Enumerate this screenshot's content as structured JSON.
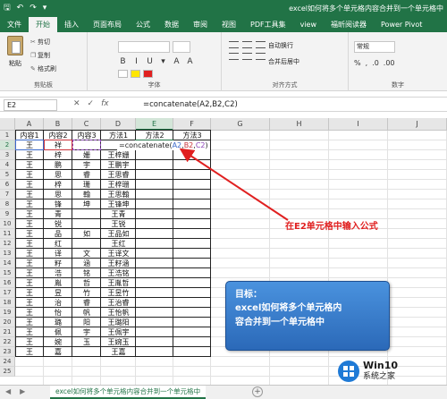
{
  "window": {
    "title": "excel如何将多个单元格内容合并到一个单元格中",
    "qat": {
      "save": "🖫",
      "undo": "↶",
      "redo": "↷",
      "more": "▾"
    }
  },
  "tabs": [
    "文件",
    "开始",
    "插入",
    "页面布局",
    "公式",
    "数据",
    "审阅",
    "视图",
    "PDF工具集",
    "view",
    "福昕阅读器",
    "Power Pivot"
  ],
  "ribbon": {
    "paste": "粘贴",
    "cut": "剪切",
    "copy": "复制",
    "format_painter": "格式刷",
    "clipboard": "剪贴板",
    "font_group": "字体",
    "font_buttons": [
      "B",
      "I",
      "U",
      "▾",
      "A",
      "A"
    ],
    "wrap_text": "自动换行",
    "merge_center": "合并后居中",
    "align_group": "对齐方式",
    "number_format": "常规",
    "number_buttons": [
      "%",
      ",",
      ".0",
      ".00"
    ],
    "number_group": "数字"
  },
  "formula_bar": {
    "name_box": "E2",
    "cancel": "✕",
    "confirm": "✓",
    "fx": "fx",
    "formula": "=concatenate(A2,B2,C2)"
  },
  "grid": {
    "columns": [
      "A",
      "B",
      "C",
      "D",
      "E",
      "F",
      "G",
      "H",
      "I",
      "J"
    ],
    "row_numbers": [
      1,
      2,
      3,
      4,
      5,
      6,
      7,
      8,
      9,
      10,
      11,
      12,
      13,
      14,
      15,
      16,
      17,
      18,
      19,
      20,
      21,
      22,
      23,
      24,
      25
    ],
    "headers": [
      "内容1",
      "内容2",
      "内容3",
      "方法1",
      "方法2",
      "方法3"
    ],
    "rows": [
      [
        "王",
        "祥",
        "",
        "",
        "",
        ""
      ],
      [
        "王",
        "梓",
        "姗",
        "王梓姗",
        "",
        ""
      ],
      [
        "王",
        "鹏",
        "宇",
        "王鹏宇",
        "",
        ""
      ],
      [
        "王",
        "思",
        "睿",
        "王思睿",
        "",
        ""
      ],
      [
        "王",
        "梓",
        "珊",
        "王梓珊",
        "",
        ""
      ],
      [
        "王",
        "思",
        "翰",
        "王思翰",
        "",
        ""
      ],
      [
        "王",
        "锋",
        "坤",
        "王锋坤",
        "",
        ""
      ],
      [
        "王",
        "青",
        "",
        "王青",
        "",
        ""
      ],
      [
        "王",
        "锐",
        "",
        "王锐",
        "",
        ""
      ],
      [
        "王",
        "品",
        "如",
        "王品如",
        "",
        ""
      ],
      [
        "王",
        "红",
        "",
        "王红",
        "",
        ""
      ],
      [
        "王",
        "译",
        "文",
        "王译文",
        "",
        ""
      ],
      [
        "王",
        "籽",
        "涵",
        "王籽涵",
        "",
        ""
      ],
      [
        "王",
        "浩",
        "铭",
        "王浩铭",
        "",
        ""
      ],
      [
        "王",
        "胤",
        "哲",
        "王胤哲",
        "",
        ""
      ],
      [
        "王",
        "昱",
        "竹",
        "王昱竹",
        "",
        ""
      ],
      [
        "王",
        "治",
        "睿",
        "王治睿",
        "",
        ""
      ],
      [
        "王",
        "怡",
        "帆",
        "王怡帆",
        "",
        ""
      ],
      [
        "王",
        "璐",
        "阳",
        "王璐阳",
        "",
        ""
      ],
      [
        "王",
        "佩",
        "宇",
        "王佩宇",
        "",
        ""
      ],
      [
        "王",
        "婉",
        "玉",
        "王婉玉",
        "",
        ""
      ],
      [
        "王",
        "嘉",
        "",
        "王嘉",
        "",
        ""
      ],
      [
        "",
        "",
        "",
        "",
        "",
        ""
      ],
      [
        "",
        "",
        "",
        "",
        "",
        ""
      ]
    ],
    "editing_formula": {
      "prefix": "=concatenate(",
      "ref_a": "A2",
      "sep1": ",",
      "ref_b": "B2",
      "sep2": ",",
      "ref_c": "C2",
      "suffix": ")"
    }
  },
  "annotation": {
    "note": "在E2单元格中输入公式",
    "bubble_title": "目标：",
    "bubble_line1": "excel如何将多个单元格内",
    "bubble_line2": "容合并到一个单元格中",
    "arrow_color": "#e02020"
  },
  "sheet": {
    "nav_prev": "◀",
    "nav_next": "▶",
    "tab": "excel如何将多个单元格内容合并到一个单元格中",
    "add": "+"
  },
  "watermark": {
    "line1": "Win10",
    "line2": "系统之家"
  },
  "colors": {
    "accent": "#217346",
    "ref_a": "#3a68c8",
    "ref_b": "#c8323a",
    "ref_c": "#8c44b8"
  }
}
